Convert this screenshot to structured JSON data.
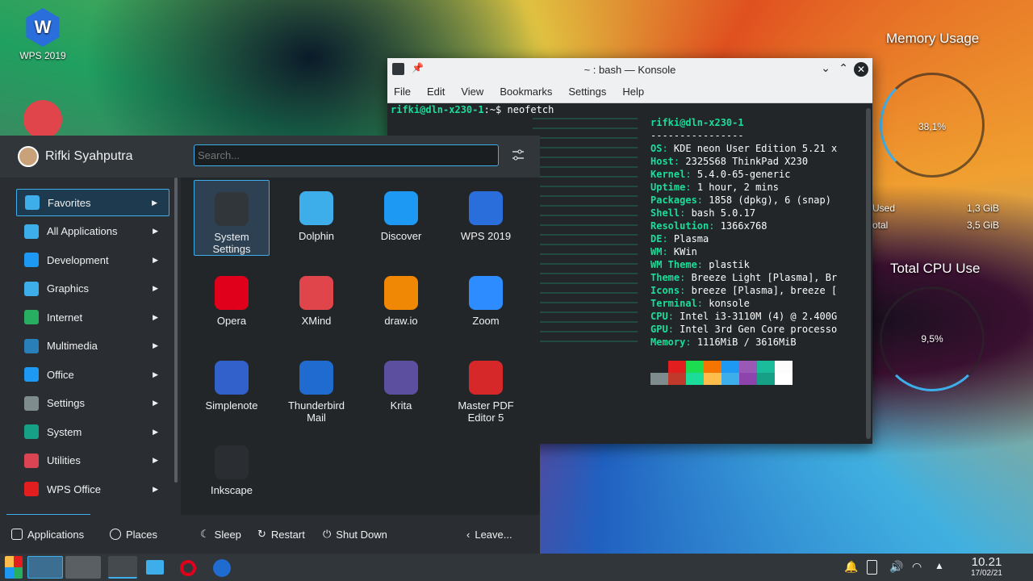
{
  "desktop": {
    "icons": [
      {
        "label": "WPS 2019"
      }
    ]
  },
  "widgets": {
    "memory": {
      "title": "Memory Usage",
      "percent": "38,1%",
      "used_label": "Used",
      "used_value": "1,3 GiB",
      "total_label": "otal",
      "total_value": "3,5 GiB"
    },
    "cpu": {
      "title": "Total CPU Use",
      "percent": "9,5%"
    }
  },
  "konsole": {
    "title": "~ : bash — Konsole",
    "menu": [
      "File",
      "Edit",
      "View",
      "Bookmarks",
      "Settings",
      "Help"
    ],
    "prompt_user": "rifki@dln-x230-1",
    "prompt_rest": ":~$ neofetch",
    "info_header": "rifki@dln-x230-1",
    "info_sep": "----------------",
    "info": [
      {
        "k": "OS",
        "v": " KDE neon User Edition 5.21 x"
      },
      {
        "k": "Host",
        "v": " 2325S68 ThinkPad X230"
      },
      {
        "k": "Kernel",
        "v": " 5.4.0-65-generic"
      },
      {
        "k": "Uptime",
        "v": " 1 hour, 2 mins"
      },
      {
        "k": "Packages",
        "v": " 1858 (dpkg), 6 (snap)"
      },
      {
        "k": "Shell",
        "v": " bash 5.0.17"
      },
      {
        "k": "Resolution",
        "v": " 1366x768"
      },
      {
        "k": "DE",
        "v": " Plasma"
      },
      {
        "k": "WM",
        "v": " KWin"
      },
      {
        "k": "WM Theme",
        "v": " plastik"
      },
      {
        "k": "Theme",
        "v": " Breeze Light [Plasma], Br"
      },
      {
        "k": "Icons",
        "v": " breeze [Plasma], breeze ["
      },
      {
        "k": "Terminal",
        "v": " konsole"
      },
      {
        "k": "CPU",
        "v": " Intel i3-3110M (4) @ 2.400G"
      },
      {
        "k": "GPU",
        "v": " Intel 3rd Gen Core processo"
      },
      {
        "k": "Memory",
        "v": " 1116MiB / 3616MiB"
      }
    ],
    "palette_top": [
      "#232629",
      "#e31e1e",
      "#1cdc50",
      "#f67400",
      "#1d99f3",
      "#9b59b6",
      "#1abc9c",
      "#fcfcfc"
    ],
    "palette_bottom": [
      "#7f8c8d",
      "#c0392b",
      "#1cdc9a",
      "#fdbc4b",
      "#3daee9",
      "#8e44ad",
      "#16a085",
      "#ffffff"
    ]
  },
  "launcher": {
    "user": "Rifki Syahputra",
    "search_placeholder": "Search...",
    "categories": [
      {
        "label": "Favorites",
        "color": "#3daee9"
      },
      {
        "label": "All Applications",
        "color": "#3daee9"
      },
      {
        "label": "Development",
        "color": "#1d99f3"
      },
      {
        "label": "Graphics",
        "color": "#3daee9"
      },
      {
        "label": "Internet",
        "color": "#27ae60"
      },
      {
        "label": "Multimedia",
        "color": "#2980b9"
      },
      {
        "label": "Office",
        "color": "#1d99f3"
      },
      {
        "label": "Settings",
        "color": "#7f8c8d"
      },
      {
        "label": "System",
        "color": "#16a085"
      },
      {
        "label": "Utilities",
        "color": "#da4453"
      },
      {
        "label": "WPS Office",
        "color": "#e31e1e"
      }
    ],
    "apps": [
      {
        "label": "System Settings",
        "color": "#31363b"
      },
      {
        "label": "Dolphin",
        "color": "#3daee9"
      },
      {
        "label": "Discover",
        "color": "#1d99f3"
      },
      {
        "label": "WPS 2019",
        "color": "#2a6edb"
      },
      {
        "label": "Opera",
        "color": "#e0001b"
      },
      {
        "label": "XMind",
        "color": "#e0454b"
      },
      {
        "label": "draw.io",
        "color": "#f08705"
      },
      {
        "label": "Zoom",
        "color": "#2d8cff"
      },
      {
        "label": "Simplenote",
        "color": "#3361cc"
      },
      {
        "label": "Thunderbird Mail",
        "color": "#1f6bd0"
      },
      {
        "label": "Krita",
        "color": "#5c4fa0"
      },
      {
        "label": "Master PDF Editor 5",
        "color": "#d62828"
      },
      {
        "label": "Inkscape",
        "color": "#2a2e32"
      }
    ],
    "footer": {
      "applications": "Applications",
      "places": "Places",
      "sleep": "Sleep",
      "restart": "Restart",
      "shutdown": "Shut Down",
      "leave": "Leave..."
    }
  },
  "taskbar": {
    "time": "10.21",
    "date": "17/02/21"
  }
}
